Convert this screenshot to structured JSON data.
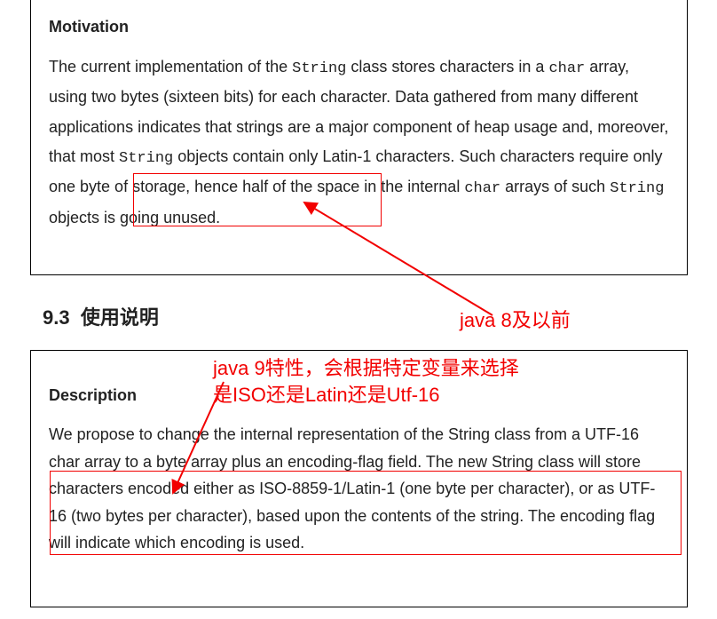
{
  "motivation": {
    "heading": "Motivation",
    "text_parts": [
      "The current implementation of the ",
      "String",
      " class stores characters in a ",
      "char",
      " array, using two bytes (sixteen bits) for each character. Data gathered from many different applications indicates that strings are a major component of heap usage and, moreover, that most ",
      "String",
      " objects contain only Latin-1 characters. Such characters require only one byte of storage, hence half of the space in the internal ",
      "char",
      " arrays of such ",
      "String",
      " objects is going unused."
    ]
  },
  "section": {
    "number": "9.3",
    "title": "使用说明"
  },
  "description": {
    "heading": "Description",
    "text": "We propose to change the internal representation of the  String class from a UTF-16  char   array to a   byte   array plus an encoding-flag field. The new   String   class will store characters encoded either as ISO-8859-1/Latin-1 (one byte per character), or as UTF-16 (two bytes per character), based upon the contents of the string. The encoding flag will indicate which encoding is used."
  },
  "annotations": {
    "label1": "java 8及以前",
    "label2_line1": "java 9特性，会根据特定变量来选择",
    "label2_line2": "是ISO还是Latin还是Utf-16"
  }
}
